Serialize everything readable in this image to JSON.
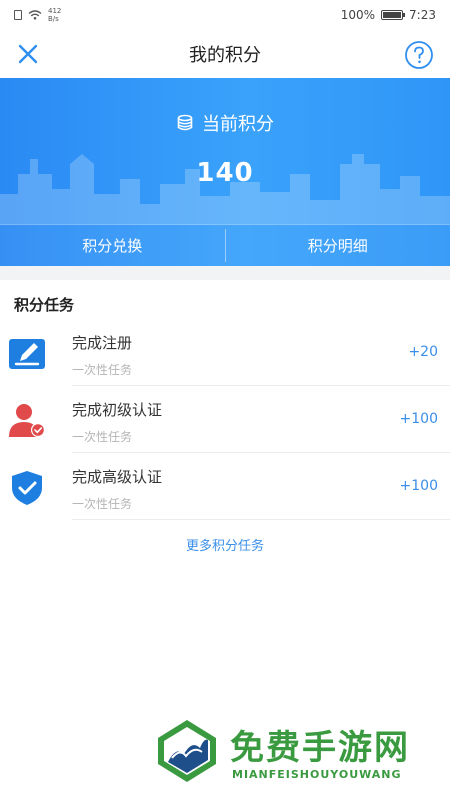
{
  "status_bar": {
    "net_speed_value": "412",
    "net_speed_unit": "B/s",
    "battery": "100%",
    "time": "7:23"
  },
  "header": {
    "title": "我的积分"
  },
  "points": {
    "label": "当前积分",
    "value": "140",
    "actions": [
      "积分兑换",
      "积分明细"
    ]
  },
  "tasks": {
    "section_title": "积分任务",
    "items": [
      {
        "name": "完成注册",
        "subtitle": "一次性任务",
        "reward": "+20",
        "icon": "edit-icon"
      },
      {
        "name": "完成初级认证",
        "subtitle": "一次性任务",
        "reward": "+100",
        "icon": "user-verified-icon"
      },
      {
        "name": "完成高级认证",
        "subtitle": "一次性任务",
        "reward": "+100",
        "icon": "shield-check-icon"
      }
    ],
    "more_label": "更多积分任务"
  },
  "watermark": {
    "title": "免费手游网",
    "subtitle": "MIANFEISHOUYOUWANG"
  },
  "colors": {
    "header_blue": "#2f96f7",
    "link_blue": "#3b8fe8",
    "watermark_green": "#3a9a3f"
  }
}
